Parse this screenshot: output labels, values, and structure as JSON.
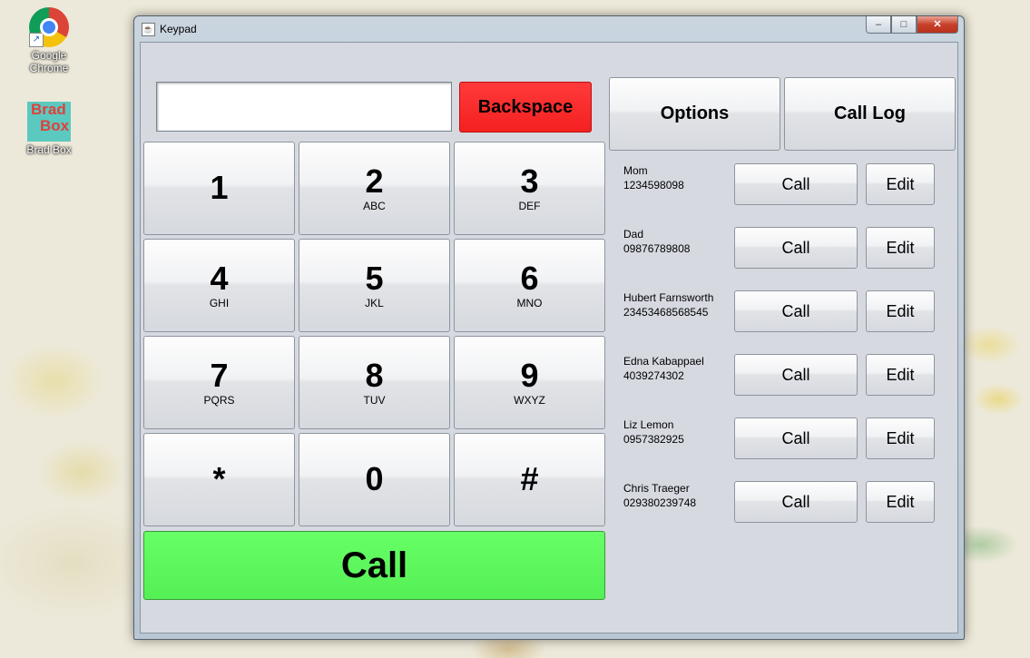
{
  "desktop": {
    "icons": [
      {
        "label_line1": "Google",
        "label_line2": "Chrome",
        "icon": "chrome-icon"
      },
      {
        "label": "Brad Box",
        "logo_text": [
          "Brad",
          "Box"
        ],
        "icon": "bradbox-icon"
      }
    ]
  },
  "window": {
    "title": "Keypad",
    "controls": {
      "minimize": "–",
      "maximize": "□",
      "close": "✕"
    }
  },
  "dial": {
    "display_value": "",
    "backspace_label": "Backspace",
    "call_label": "Call",
    "keys": [
      {
        "digit": "1",
        "letters": ""
      },
      {
        "digit": "2",
        "letters": "ABC"
      },
      {
        "digit": "3",
        "letters": "DEF"
      },
      {
        "digit": "4",
        "letters": "GHI"
      },
      {
        "digit": "5",
        "letters": "JKL"
      },
      {
        "digit": "6",
        "letters": "MNO"
      },
      {
        "digit": "7",
        "letters": "PQRS"
      },
      {
        "digit": "8",
        "letters": "TUV"
      },
      {
        "digit": "9",
        "letters": "WXYZ"
      },
      {
        "digit": "*",
        "letters": ""
      },
      {
        "digit": "0",
        "letters": ""
      },
      {
        "digit": "#",
        "letters": ""
      }
    ]
  },
  "top_buttons": {
    "options": "Options",
    "call_log": "Call Log"
  },
  "contacts": [
    {
      "name": "Mom",
      "number": "1234598098",
      "call": "Call",
      "edit": "Edit"
    },
    {
      "name": "Dad",
      "number": "09876789808",
      "call": "Call",
      "edit": "Edit"
    },
    {
      "name": "Hubert Farnsworth",
      "number": "23453468568545",
      "call": "Call",
      "edit": "Edit"
    },
    {
      "name": "Edna Kabappael",
      "number": "4039274302",
      "call": "Call",
      "edit": "Edit"
    },
    {
      "name": "Liz Lemon",
      "number": "0957382925",
      "call": "Call",
      "edit": "Edit"
    },
    {
      "name": "Chris Traeger",
      "number": "029380239748",
      "call": "Call",
      "edit": "Edit"
    }
  ],
  "colors": {
    "backspace": "#f42020",
    "call": "#5cff5c",
    "panel": "#d6d9e0"
  }
}
